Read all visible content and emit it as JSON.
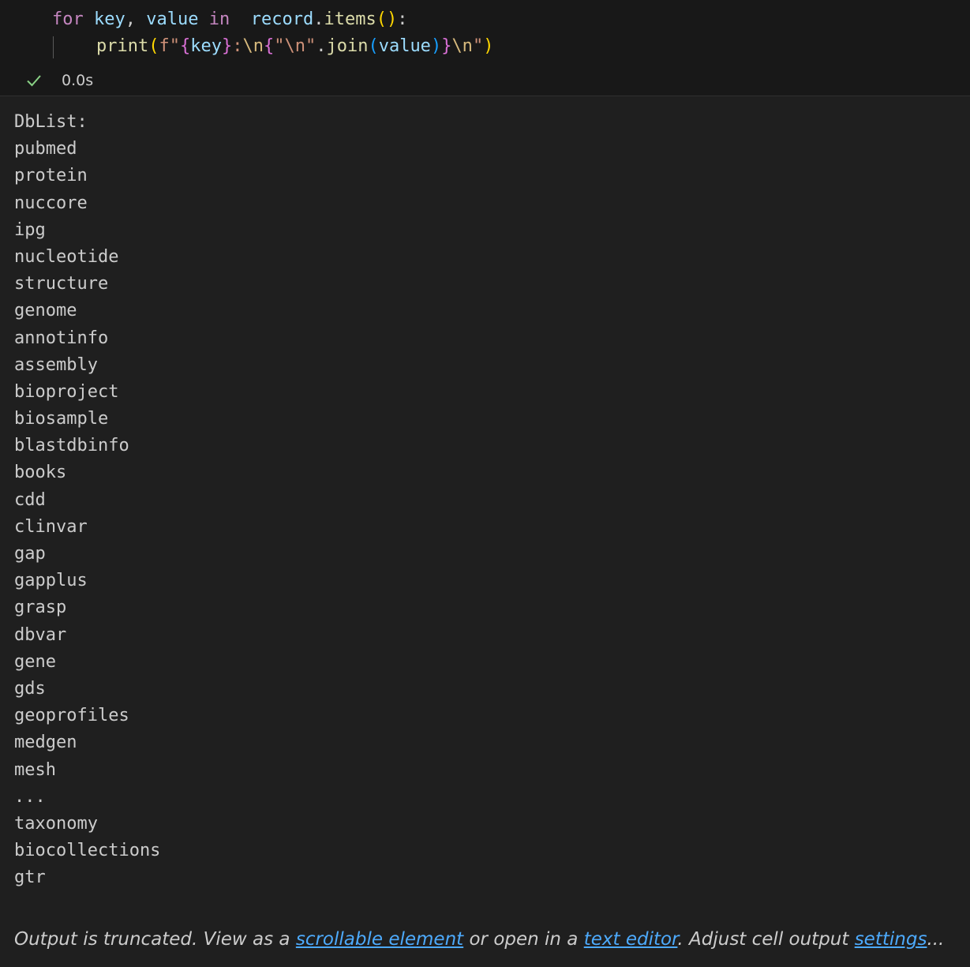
{
  "code": {
    "line1": {
      "kw_for": "for",
      "var_key": "key",
      "comma": ",",
      "var_value": "value",
      "kw_in": "in",
      "obj": "record",
      "dot": ".",
      "method": "items",
      "paren_open": "(",
      "paren_close": ")",
      "colon": ":"
    },
    "line2": {
      "fn": "print",
      "p_open": "(",
      "prefix": "f",
      "q1": "\"",
      "b1_open": "{",
      "b1_var": "key",
      "b1_close": "}",
      "lit1": ":",
      "esc1": "\\n",
      "b2_open": "{",
      "inner_str": "\"\\n\"",
      "dot": ".",
      "join": "join",
      "j_open": "(",
      "j_var": "value",
      "j_close": ")",
      "b2_close": "}",
      "esc2": "\\n",
      "q2": "\"",
      "p_close": ")"
    }
  },
  "status": {
    "icon": "check-icon",
    "time": "0.0s",
    "success_color": "#89d185"
  },
  "output_lines": [
    "DbList:",
    "pubmed",
    "protein",
    "nuccore",
    "ipg",
    "nucleotide",
    "structure",
    "genome",
    "annotinfo",
    "assembly",
    "bioproject",
    "biosample",
    "blastdbinfo",
    "books",
    "cdd",
    "clinvar",
    "gap",
    "gapplus",
    "grasp",
    "dbvar",
    "gene",
    "gds",
    "geoprofiles",
    "medgen",
    "mesh",
    "...",
    "taxonomy",
    "biocollections",
    "gtr"
  ],
  "truncation": {
    "text1": "Output is truncated. View as a ",
    "link1": "scrollable element",
    "text2": " or open in a ",
    "link2": "text editor",
    "text3": ". Adjust cell output ",
    "link3": "settings",
    "text4": "...",
    "link_color": "#4daafc"
  }
}
